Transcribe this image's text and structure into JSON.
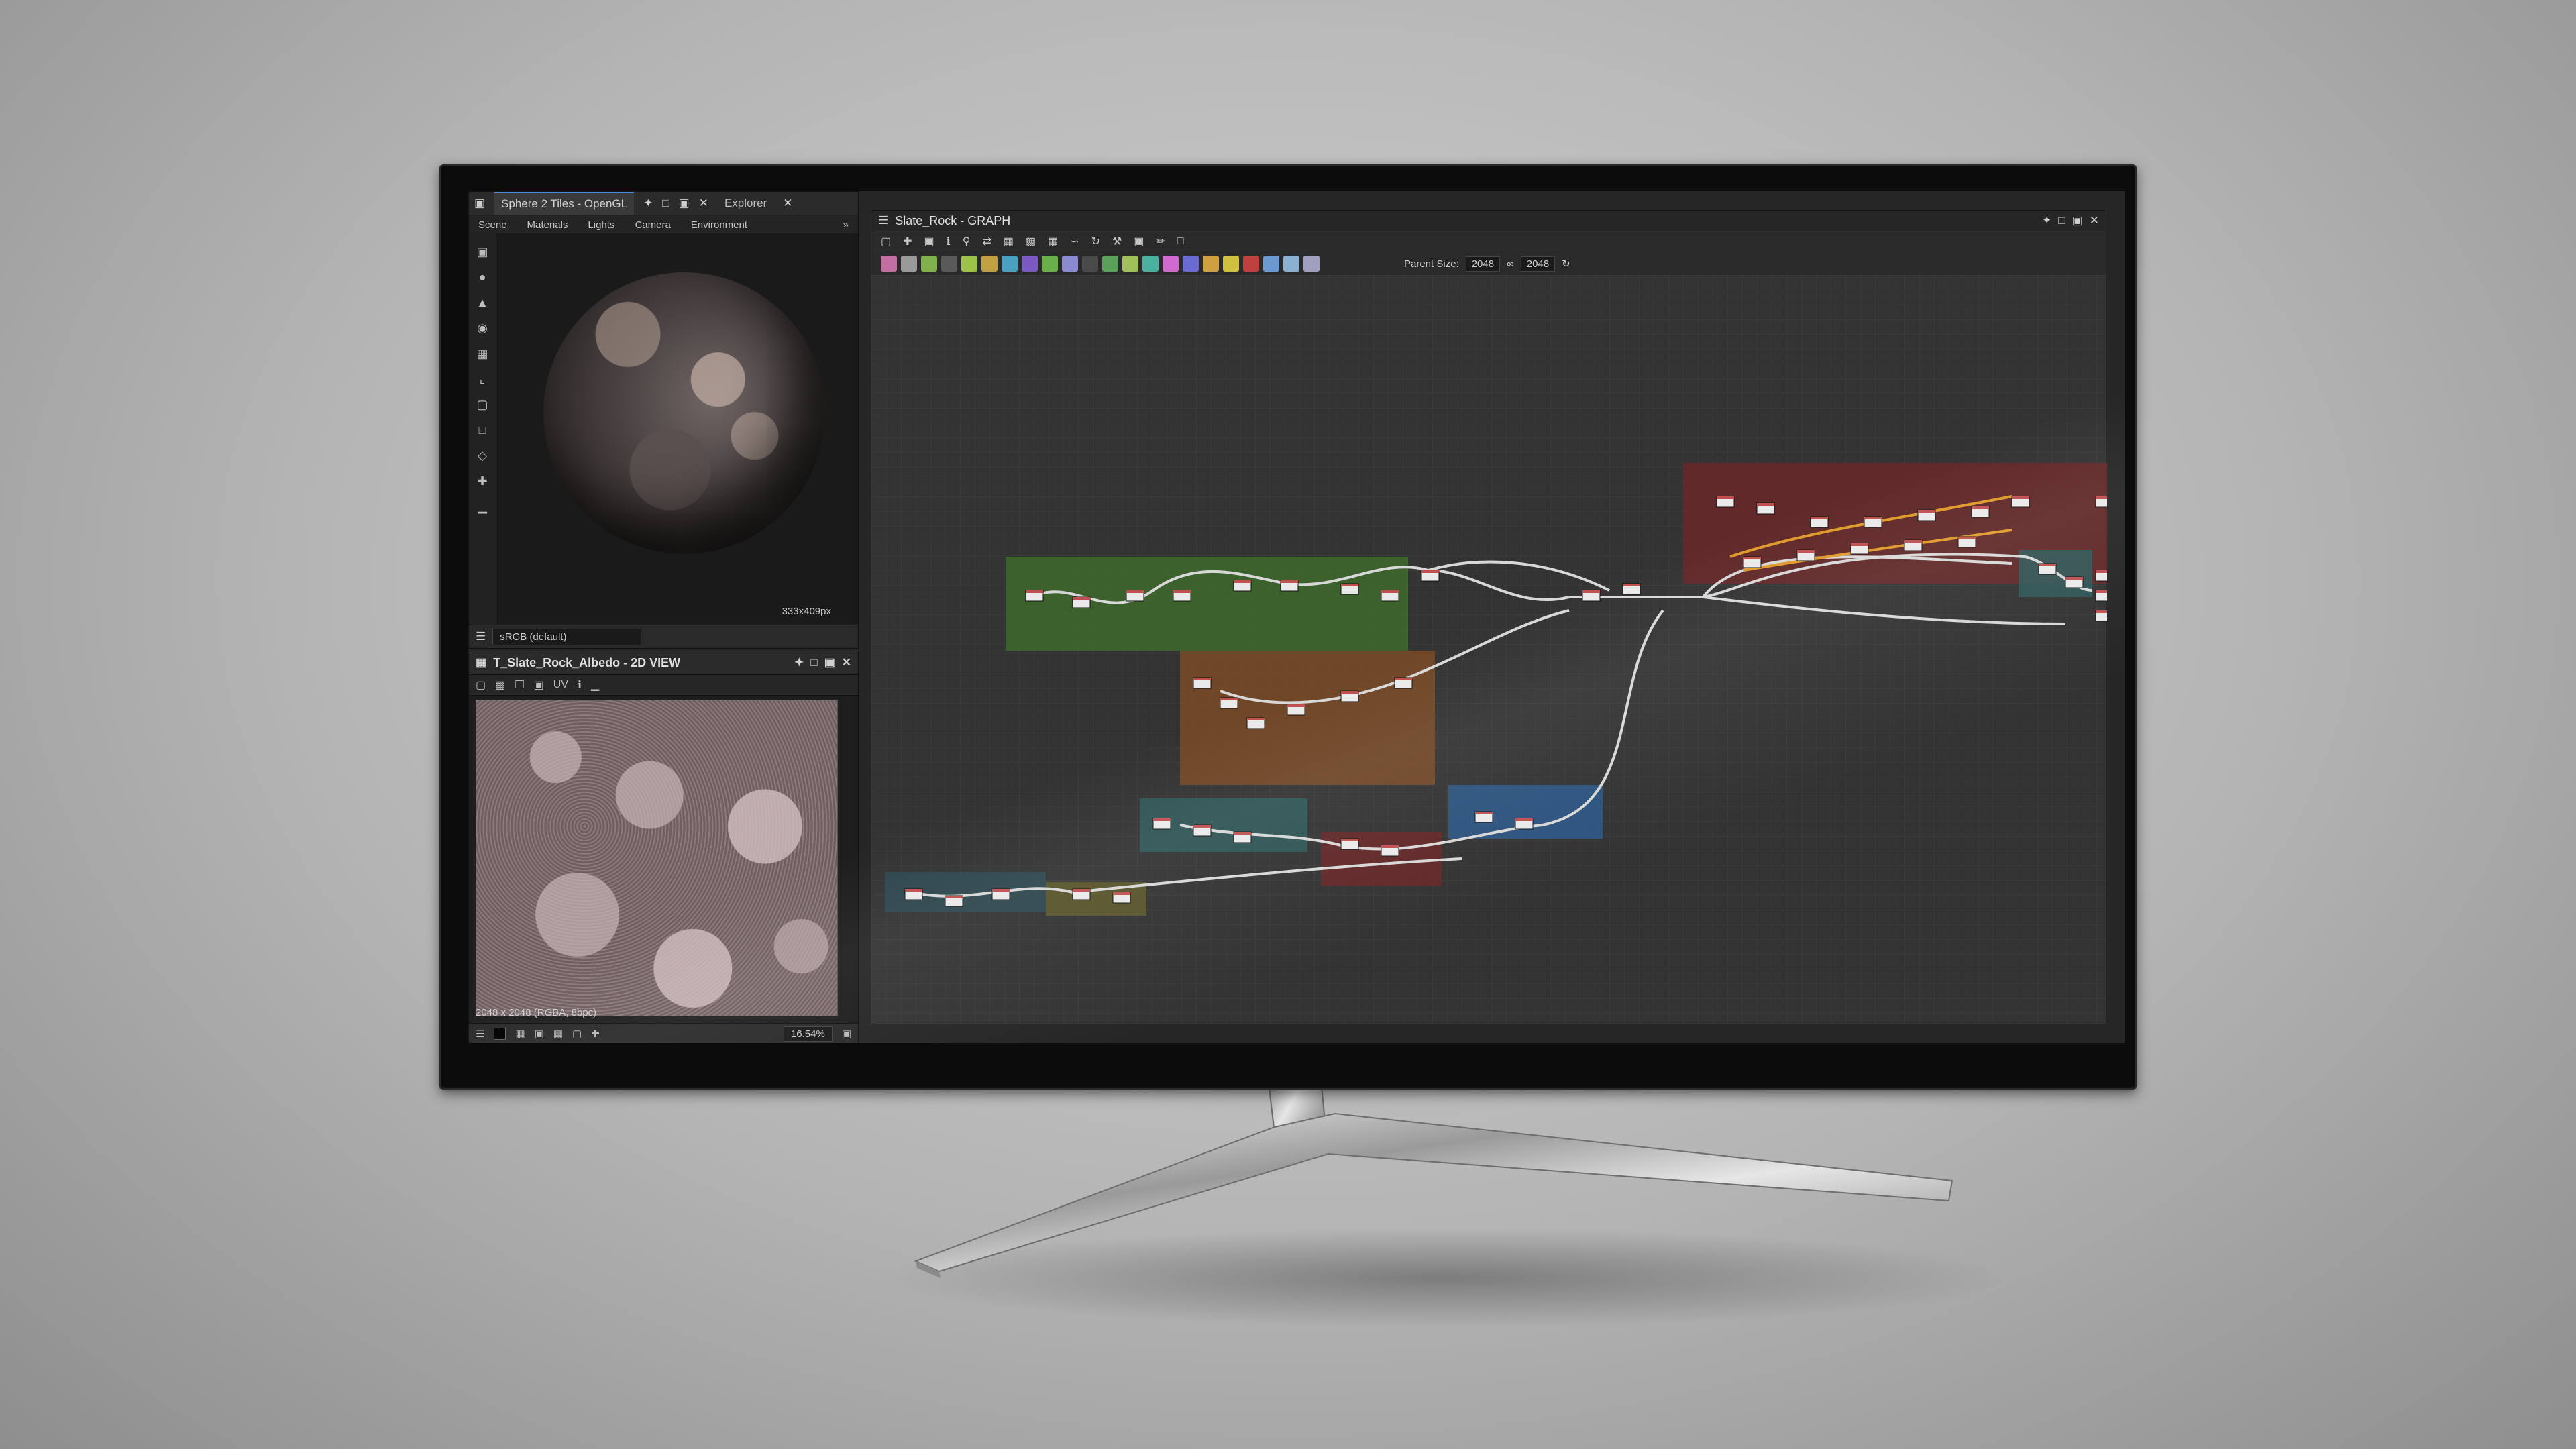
{
  "explorer_panel": {
    "title": "Sphere 2 Tiles - OpenGL",
    "explorer_tab": "Explorer",
    "tabs": [
      "Scene",
      "Materials",
      "Lights",
      "Camera",
      "Environment"
    ],
    "resolution": "333x409px",
    "colorspace": "sRGB (default)"
  },
  "view2d_panel": {
    "title": "T_Slate_Rock_Albedo - 2D VIEW",
    "uv_label": "UV",
    "texture_info": "2048 x 2048 (RGBA, 8bpc)",
    "zoom": "16.54%"
  },
  "graph_panel": {
    "title": "Slate_Rock - GRAPH",
    "parent_size_label": "Parent Size:",
    "parent_size_value": "2048",
    "size_value": "2048"
  },
  "colors": {
    "frame_green": "#3e6a2c",
    "frame_orange": "#7a4a26",
    "frame_teal": "#2f5b5a",
    "frame_blue": "#2d5a8c",
    "frame_red": "#6a2828",
    "frame_olive": "#5e5a2a",
    "frame_slate": "#2e4a52",
    "wire": "#d8d8d8",
    "wire_orange": "#e09a2a"
  },
  "icons": [
    "pin-icon",
    "float-icon",
    "maximize-icon",
    "close-icon",
    "camera-icon",
    "light-icon",
    "environment-icon",
    "grid-icon",
    "axis-icon",
    "cube-icon",
    "info-icon",
    "histogram-icon",
    "save-icon",
    "search-icon"
  ]
}
